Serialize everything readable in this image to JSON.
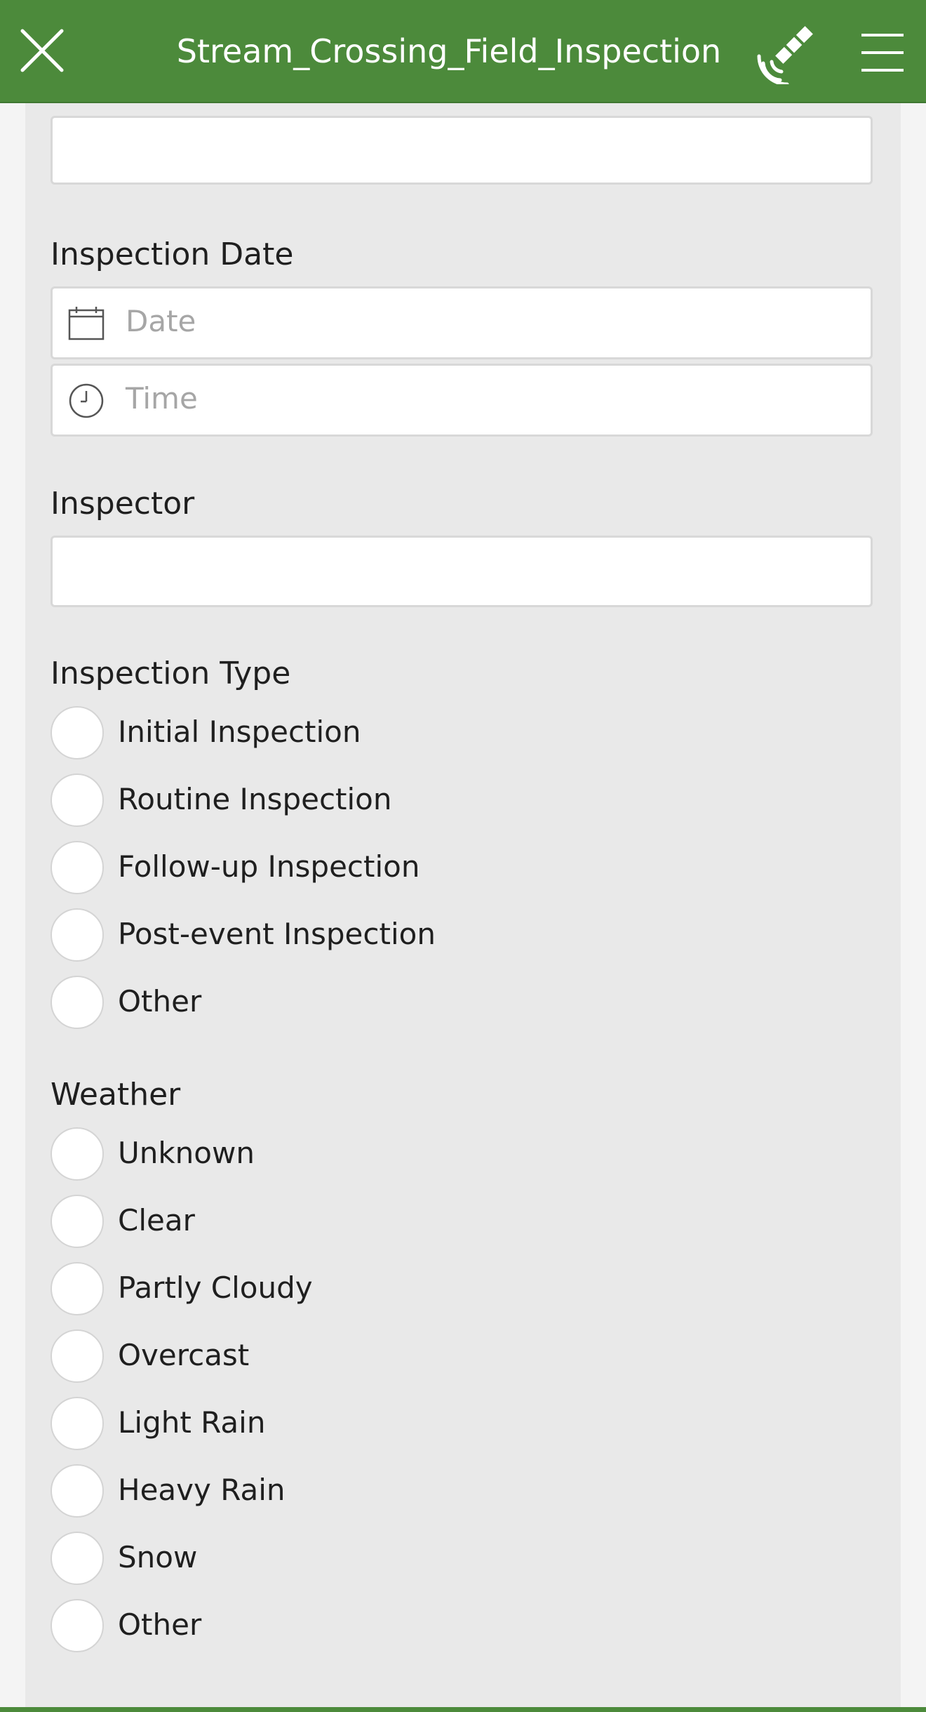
{
  "header": {
    "title": "Stream_Crossing_Field_Inspection",
    "close_icon": "close-icon",
    "gps_icon": "satellite-signal-icon",
    "menu_icon": "hamburger-menu-icon",
    "background_color": "#4c8a3b"
  },
  "fields": {
    "top_field": {
      "value": ""
    },
    "inspection_date": {
      "label": "Inspection Date",
      "date_placeholder": "Date",
      "time_placeholder": "Time",
      "date_icon": "calendar-icon",
      "time_icon": "clock-icon"
    },
    "inspector": {
      "label": "Inspector",
      "value": ""
    },
    "inspection_type": {
      "label": "Inspection Type",
      "options": [
        "Initial Inspection",
        "Routine Inspection",
        "Follow-up Inspection",
        "Post-event Inspection",
        "Other"
      ]
    },
    "weather": {
      "label": "Weather",
      "options": [
        "Unknown",
        "Clear",
        "Partly Cloudy",
        "Overcast",
        "Light Rain",
        "Heavy Rain",
        "Snow",
        "Other"
      ]
    }
  }
}
